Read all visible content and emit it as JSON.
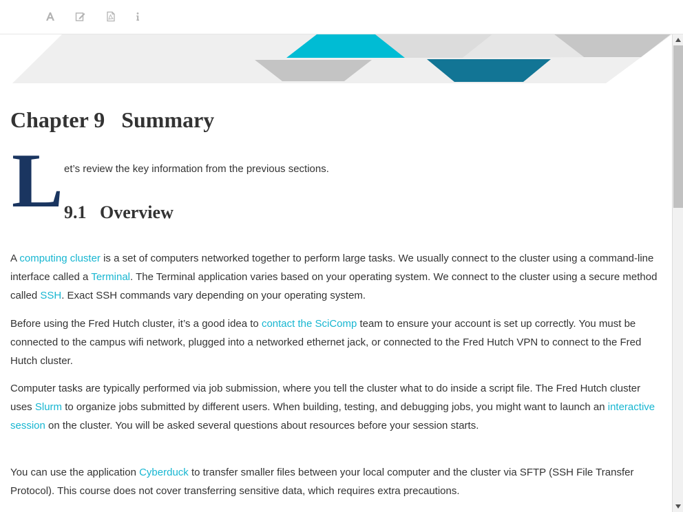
{
  "toolbar": {
    "buttons": [
      {
        "name": "font-settings",
        "icon": "font-icon"
      },
      {
        "name": "edit",
        "icon": "edit-icon"
      },
      {
        "name": "pdf-download",
        "icon": "pdf-icon"
      },
      {
        "name": "info",
        "icon": "info-icon"
      }
    ]
  },
  "chapter": {
    "title": "Chapter 9   Summary",
    "dropcap": "L",
    "intro": "et’s review the key information from the previous sections."
  },
  "section": {
    "title": "9.1   Overview"
  },
  "paragraphs": {
    "p1": {
      "t1": "A ",
      "l1": "computing cluster",
      "t2": " is a set of computers networked together to perform large tasks. We usually connect to the cluster using a command-line interface called a ",
      "l2": "Terminal",
      "t3": ". The Terminal application varies based on your operating system. We connect to the cluster using a secure method called ",
      "l3": "SSH",
      "t4": ". Exact SSH commands vary depending on your operating system."
    },
    "p2": {
      "t1": "Before using the Fred Hutch cluster, it’s a good idea to ",
      "l1": "contact the SciComp",
      "t2": " team to ensure your account is set up correctly. You must be connected to the campus wifi network, plugged into a networked ethernet jack, or connected to the Fred Hutch VPN to connect to the Fred Hutch cluster."
    },
    "p3": {
      "t1": "Computer tasks are typically performed via job submission, where you tell the cluster what to do inside a script file. The Fred Hutch cluster uses ",
      "l1": "Slurm",
      "t2": " to organize jobs submitted by different users. When building, testing, and debugging jobs, you might want to launch an ",
      "l2": "interactive session",
      "t3": " on the cluster. You will be asked several questions about resources before your session starts."
    },
    "p4": {
      "t1": "You can use the application ",
      "l1": "Cyberduck",
      "t2": " to transfer smaller files between your local computer and the cluster via SFTP (SSH File Transfer Protocol). This course does not cover transferring sensitive data, which requires extra precautions."
    }
  },
  "colors": {
    "link": "#17b6d1",
    "dropcap": "#1a3560",
    "banner_teal": "#00bcd4",
    "banner_dark_teal": "#127595",
    "banner_gray": "#c8c8c8"
  }
}
